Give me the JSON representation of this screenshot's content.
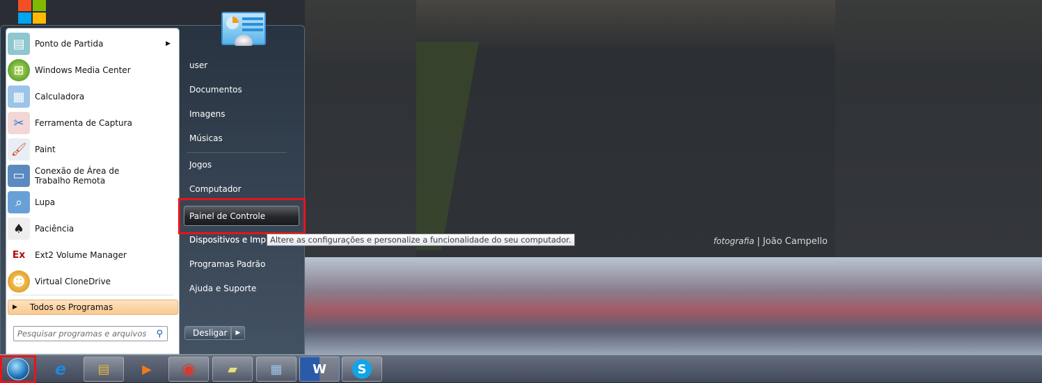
{
  "desktop": {
    "watermark_prefix": "fotografia",
    "watermark_name": "| João Campello"
  },
  "start_menu": {
    "programs": [
      {
        "label": "Ponto de Partida",
        "icon": "getting-started-icon",
        "has_submenu": true
      },
      {
        "label": "Windows Media Center",
        "icon": "media-center-icon"
      },
      {
        "label": "Calculadora",
        "icon": "calculator-icon"
      },
      {
        "label": "Ferramenta de Captura",
        "icon": "snipping-tool-icon"
      },
      {
        "label": "Paint",
        "icon": "paint-icon"
      },
      {
        "label": "Conexão de Área de Trabalho Remota",
        "icon": "remote-desktop-icon"
      },
      {
        "label": "Lupa",
        "icon": "magnifier-icon"
      },
      {
        "label": "Paciência",
        "icon": "solitaire-icon"
      },
      {
        "label": "Ext2 Volume Manager",
        "icon": "ext2-icon"
      },
      {
        "label": "Virtual CloneDrive",
        "icon": "clonedrive-icon"
      }
    ],
    "all_programs": "Todos os Programas",
    "search_placeholder": "Pesquisar programas e arquivos",
    "right_items": [
      "user",
      "Documentos",
      "Imagens",
      "Músicas",
      "Jogos",
      "Computador",
      "Painel de Controle",
      "Dispositivos e Impressoras",
      "Programas Padrão",
      "Ajuda e Suporte"
    ],
    "right_visible": [
      "user",
      "Documentos",
      "Imagens",
      "Músicas",
      "Jogos",
      "Computador",
      "Painel de Controle",
      "Dispositivos e Impres",
      "Programas Padrão",
      "Ajuda e Suporte"
    ],
    "highlighted": "Painel de Controle",
    "shutdown_label": "Desligar",
    "tooltip": "Altere as configurações e personalize a funcionalidade do seu computador."
  },
  "taskbar": {
    "apps": [
      {
        "name": "internet-explorer",
        "glyph": "e",
        "color": "#1e88d8"
      },
      {
        "name": "windows-explorer",
        "glyph": "▤",
        "color": "#e8b63a"
      },
      {
        "name": "media-player",
        "glyph": "▶",
        "color": "#f07a1a"
      },
      {
        "name": "chrome",
        "glyph": "◉",
        "color": "#d93a2e"
      },
      {
        "name": "sticky-notes",
        "glyph": "▰",
        "color": "#e8e07a"
      },
      {
        "name": "calculator",
        "glyph": "▦",
        "color": "#9cc4e8"
      },
      {
        "name": "word",
        "glyph": "W",
        "color": "#2a5aa8"
      },
      {
        "name": "skype",
        "glyph": "S",
        "color": "#12a4e8"
      }
    ]
  },
  "colors": {
    "highlight_box": "#e8141c",
    "all_programs_bg": "#fbc990"
  }
}
